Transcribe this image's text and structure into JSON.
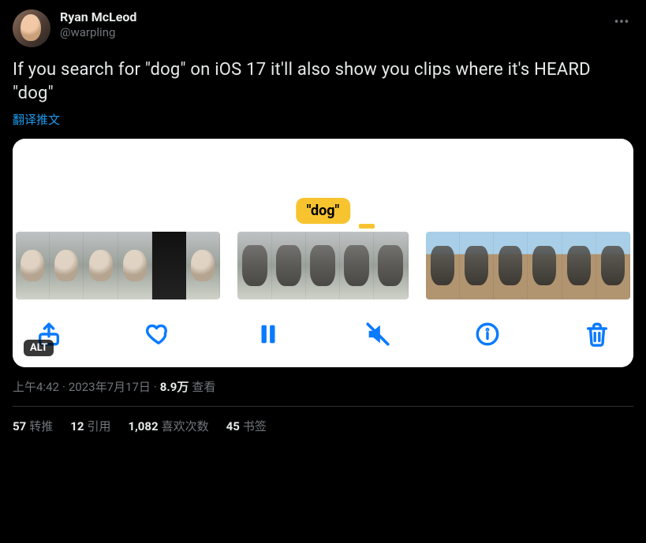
{
  "user": {
    "display_name": "Ryan McLeod",
    "handle": "@warpling"
  },
  "tweet": {
    "text": "If you search for \"dog\" on iOS 17 it'll also show you clips where it's HEARD \"dog\"",
    "translate_label": "翻译推文",
    "caption_word": "\"dog\"",
    "alt_badge": "ALT"
  },
  "meta": {
    "time": "上午4:42",
    "dot1": " · ",
    "date": "2023年7月17日",
    "dot2": " · ",
    "views_count": "8.9万",
    "views_label": " 查看"
  },
  "stats": {
    "retweets_count": "57",
    "retweets_label": "转推",
    "quotes_count": "12",
    "quotes_label": "引用",
    "likes_count": "1,082",
    "likes_label": "喜欢次数",
    "bookmarks_count": "45",
    "bookmarks_label": "书签"
  }
}
